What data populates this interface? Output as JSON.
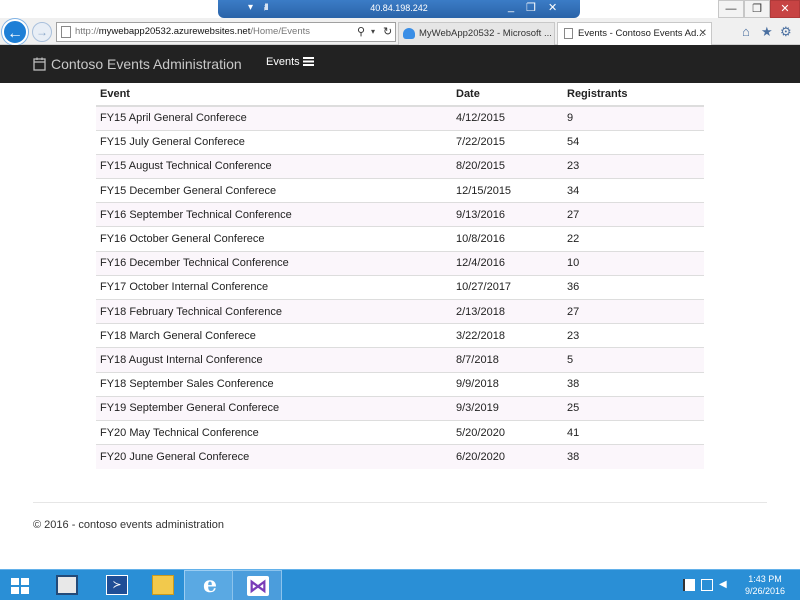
{
  "remote_session": {
    "ip": "40.84.198.242",
    "pin_icon": "pin-icon",
    "signal_icon": "signal-icon",
    "minimize_glyph": "_",
    "restore_glyph": "❐",
    "close_glyph": "✕"
  },
  "window_controls": {
    "minimize": "—",
    "maximize": "❐",
    "close": "✕"
  },
  "browser": {
    "back_glyph": "←",
    "forward_glyph": "→",
    "url_scheme": "http://",
    "url_host": "mywebapp20532.azurewebsites.net",
    "url_path": "/Home/Events",
    "search_glyph": "⚲",
    "refresh_glyph": "↻",
    "tabs": [
      {
        "title": "MyWebApp20532 - Microsoft ...",
        "icon": "cloud-icon",
        "active": false
      },
      {
        "title": "Events - Contoso Events Ad...",
        "icon": "page-icon",
        "active": true
      }
    ],
    "tab_close_glyph": "✕",
    "home_glyph": "⌂",
    "favorites_glyph": "★",
    "settings_glyph": "⚙"
  },
  "navbar": {
    "brand": "Contoso Events Administration",
    "events_link": "Events"
  },
  "table": {
    "headers": {
      "event": "Event",
      "date": "Date",
      "registrants": "Registrants"
    },
    "rows": [
      {
        "event": "FY15 April General Conferece",
        "date": "4/12/2015",
        "registrants": "9"
      },
      {
        "event": "FY15 July General Conferece",
        "date": "7/22/2015",
        "registrants": "54"
      },
      {
        "event": "FY15 August Technical Conference",
        "date": "8/20/2015",
        "registrants": "23"
      },
      {
        "event": "FY15 December General Conferece",
        "date": "12/15/2015",
        "registrants": "34"
      },
      {
        "event": "FY16 September Technical Conference",
        "date": "9/13/2016",
        "registrants": "27"
      },
      {
        "event": "FY16 October General Conferece",
        "date": "10/8/2016",
        "registrants": "22"
      },
      {
        "event": "FY16 December Technical Conference",
        "date": "12/4/2016",
        "registrants": "10"
      },
      {
        "event": "FY17 October Internal Conference",
        "date": "10/27/2017",
        "registrants": "36"
      },
      {
        "event": "FY18 February Technical Conference",
        "date": "2/13/2018",
        "registrants": "27"
      },
      {
        "event": "FY18 March General Conferece",
        "date": "3/22/2018",
        "registrants": "23"
      },
      {
        "event": "FY18 August Internal Conference",
        "date": "8/7/2018",
        "registrants": "5"
      },
      {
        "event": "FY18 September Sales Conference",
        "date": "9/9/2018",
        "registrants": "38"
      },
      {
        "event": "FY19 September General Conferece",
        "date": "9/3/2019",
        "registrants": "25"
      },
      {
        "event": "FY20 May Technical Conference",
        "date": "5/20/2020",
        "registrants": "41"
      },
      {
        "event": "FY20 June General Conferece",
        "date": "6/20/2020",
        "registrants": "38"
      }
    ]
  },
  "footer": {
    "text": "© 2016 - contoso events administration"
  },
  "taskbar": {
    "powershell_glyph": "≻",
    "ie_glyph": "e",
    "vs_glyph": "⋈",
    "volume_glyph": "◀",
    "time": "1:43 PM",
    "date": "9/26/2016"
  },
  "colors": {
    "navbar_bg": "#222222",
    "taskbar_bg": "#2a8fd6",
    "row_stripe": "#fbf6fb",
    "rdp_bar": "#2a63a8"
  }
}
